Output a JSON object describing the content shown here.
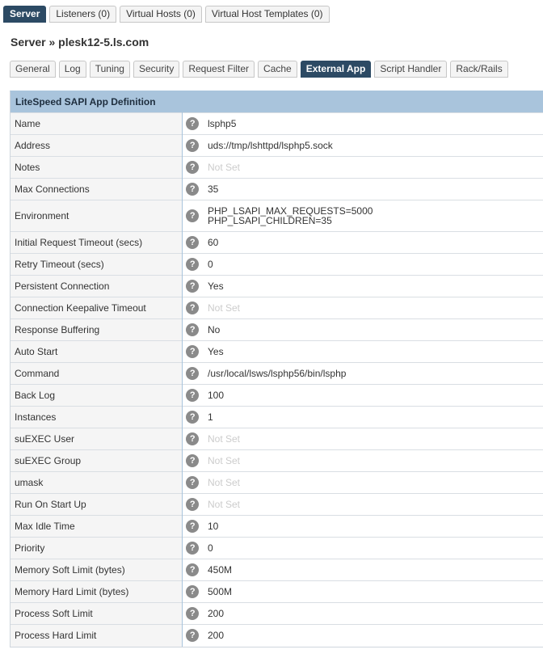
{
  "top_tabs": [
    {
      "label": "Server",
      "active": true
    },
    {
      "label": "Listeners (0)",
      "active": false
    },
    {
      "label": "Virtual Hosts (0)",
      "active": false
    },
    {
      "label": "Virtual Host Templates (0)",
      "active": false
    }
  ],
  "page_title": "Server » plesk12-5.ls.com",
  "sub_tabs": [
    {
      "label": "General",
      "active": false
    },
    {
      "label": "Log",
      "active": false
    },
    {
      "label": "Tuning",
      "active": false
    },
    {
      "label": "Security",
      "active": false
    },
    {
      "label": "Request Filter",
      "active": false
    },
    {
      "label": "Cache",
      "active": false
    },
    {
      "label": "External App",
      "active": true
    },
    {
      "label": "Script Handler",
      "active": false
    },
    {
      "label": "Rack/Rails",
      "active": false
    }
  ],
  "panel": {
    "title": "LiteSpeed SAPI App Definition",
    "help_glyph": "?",
    "rows": [
      {
        "label": "Name",
        "value": "lsphp5"
      },
      {
        "label": "Address",
        "value": "uds://tmp/lshttpd/lsphp5.sock"
      },
      {
        "label": "Notes",
        "value": "Not Set",
        "not_set": true
      },
      {
        "label": "Max Connections",
        "value": "35"
      },
      {
        "label": "Environment",
        "value_lines": [
          "PHP_LSAPI_MAX_REQUESTS=5000",
          "PHP_LSAPI_CHILDREN=35"
        ]
      },
      {
        "label": "Initial Request Timeout (secs)",
        "value": "60"
      },
      {
        "label": "Retry Timeout (secs)",
        "value": "0"
      },
      {
        "label": "Persistent Connection",
        "value": "Yes"
      },
      {
        "label": "Connection Keepalive Timeout",
        "value": "Not Set",
        "not_set": true
      },
      {
        "label": "Response Buffering",
        "value": "No"
      },
      {
        "label": "Auto Start",
        "value": "Yes"
      },
      {
        "label": "Command",
        "value": "/usr/local/lsws/lsphp56/bin/lsphp"
      },
      {
        "label": "Back Log",
        "value": "100"
      },
      {
        "label": "Instances",
        "value": "1"
      },
      {
        "label": "suEXEC User",
        "value": "Not Set",
        "not_set": true
      },
      {
        "label": "suEXEC Group",
        "value": "Not Set",
        "not_set": true
      },
      {
        "label": "umask",
        "value": "Not Set",
        "not_set": true
      },
      {
        "label": "Run On Start Up",
        "value": "Not Set",
        "not_set": true
      },
      {
        "label": "Max Idle Time",
        "value": "10"
      },
      {
        "label": "Priority",
        "value": "0"
      },
      {
        "label": "Memory Soft Limit (bytes)",
        "value": "450M"
      },
      {
        "label": "Memory Hard Limit (bytes)",
        "value": "500M"
      },
      {
        "label": "Process Soft Limit",
        "value": "200"
      },
      {
        "label": "Process Hard Limit",
        "value": "200"
      }
    ]
  },
  "colors": {
    "active_tab": "#2c4a64",
    "panel_header": "#a9c4dc",
    "not_set_text": "#cccccc"
  }
}
